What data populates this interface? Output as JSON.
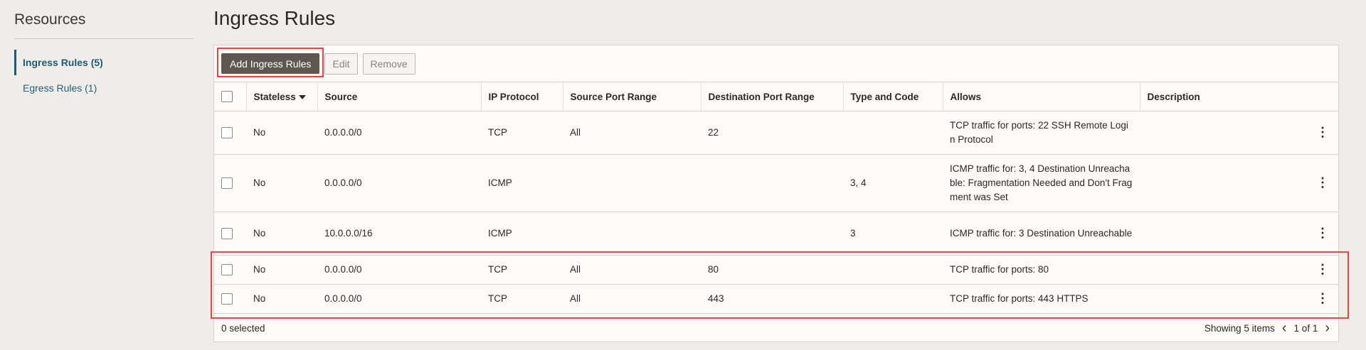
{
  "sidebar": {
    "title": "Resources",
    "items": [
      {
        "label": "Ingress Rules (5)",
        "active": true
      },
      {
        "label": "Egress Rules (1)",
        "active": false
      }
    ]
  },
  "page": {
    "title": "Ingress Rules"
  },
  "toolbar": {
    "add_label": "Add Ingress Rules",
    "edit_label": "Edit",
    "remove_label": "Remove"
  },
  "table": {
    "headers": [
      "Stateless",
      "Source",
      "IP Protocol",
      "Source Port Range",
      "Destination Port Range",
      "Type and Code",
      "Allows",
      "Description"
    ],
    "rows": [
      {
        "stateless": "No",
        "source": "0.0.0.0/0",
        "protocol": "TCP",
        "src_port": "All",
        "dst_port": "22",
        "type_code": "",
        "allows": "TCP traffic for ports: 22 SSH Remote Login Protocol",
        "description": ""
      },
      {
        "stateless": "No",
        "source": "0.0.0.0/0",
        "protocol": "ICMP",
        "src_port": "",
        "dst_port": "",
        "type_code": "3, 4",
        "allows": "ICMP traffic for: 3, 4 Destination Unreachable: Fragmentation Needed and Don't Fragment was Set",
        "description": ""
      },
      {
        "stateless": "No",
        "source": "10.0.0.0/16",
        "protocol": "ICMP",
        "src_port": "",
        "dst_port": "",
        "type_code": "3",
        "allows": "ICMP traffic for: 3 Destination Unreachable",
        "description": ""
      },
      {
        "stateless": "No",
        "source": "0.0.0.0/0",
        "protocol": "TCP",
        "src_port": "All",
        "dst_port": "80",
        "type_code": "",
        "allows": "TCP traffic for ports: 80",
        "description": ""
      },
      {
        "stateless": "No",
        "source": "0.0.0.0/0",
        "protocol": "TCP",
        "src_port": "All",
        "dst_port": "443",
        "type_code": "",
        "allows": "TCP traffic for ports: 443 HTTPS",
        "description": ""
      }
    ]
  },
  "footer": {
    "selected": "0 selected",
    "showing": "Showing 5 items",
    "page": "1 of 1"
  },
  "icons": {
    "kebab": "kebab-menu-icon",
    "sort": "sort-desc-icon",
    "prev": "chevron-left-icon",
    "next": "chevron-right-icon"
  },
  "colors": {
    "accent": "#1e5a73",
    "primary_button": "#5e574f",
    "highlight": "#e8423f"
  }
}
